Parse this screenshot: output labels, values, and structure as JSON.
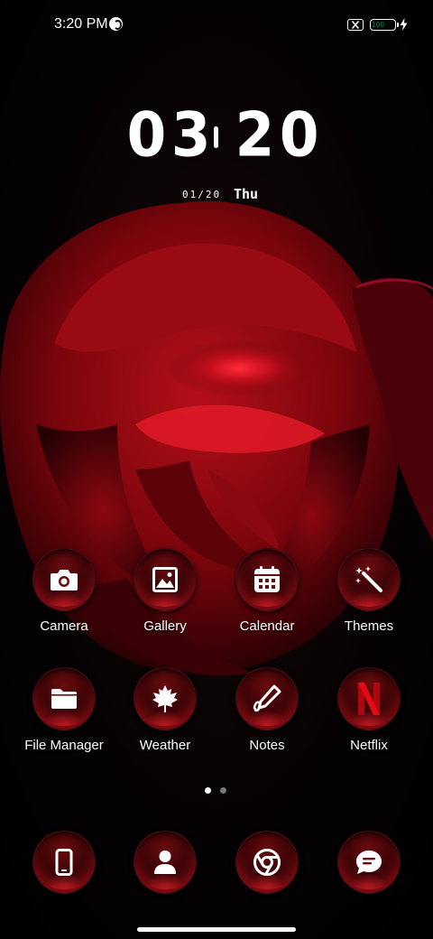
{
  "status_bar": {
    "time": "3:20 PM",
    "battery_level": "100",
    "battery_color": "#4fd14a",
    "icons": [
      "app-notification-icon",
      "no-sim-icon",
      "battery-icon",
      "charging-icon"
    ]
  },
  "clock": {
    "hours": "03",
    "minutes": "20",
    "date": "01/20",
    "day": "Thu"
  },
  "home_apps": [
    {
      "label": "Camera",
      "icon": "camera-icon"
    },
    {
      "label": "Gallery",
      "icon": "gallery-icon"
    },
    {
      "label": "Calendar",
      "icon": "calendar-icon"
    },
    {
      "label": "Themes",
      "icon": "magic-wand-icon"
    },
    {
      "label": "File Manager",
      "icon": "folder-icon"
    },
    {
      "label": "Weather",
      "icon": "weather-leaf-icon"
    },
    {
      "label": "Notes",
      "icon": "notes-pen-icon"
    },
    {
      "label": "Netflix",
      "icon": "netflix-icon"
    }
  ],
  "dock": [
    {
      "icon": "phone-icon"
    },
    {
      "icon": "contacts-icon"
    },
    {
      "icon": "chrome-icon"
    },
    {
      "icon": "messages-icon"
    }
  ],
  "pages": {
    "count": 2,
    "active": 1
  },
  "theme": {
    "accent": "#d2141e",
    "wallpaper": "red rose"
  }
}
